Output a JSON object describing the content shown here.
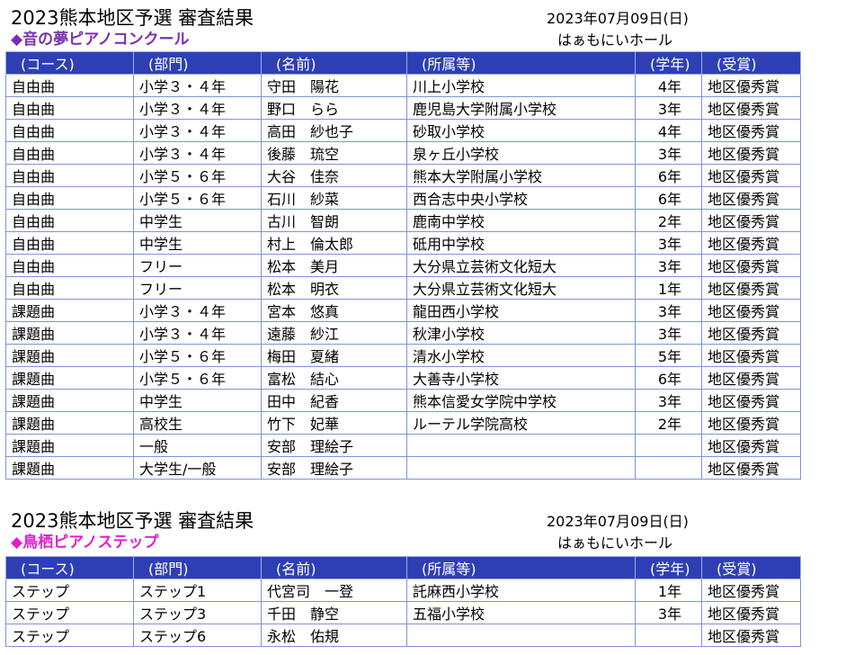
{
  "sections": [
    {
      "title": "2023熊本地区予選 審査結果",
      "date": "2023年07月09日(日)",
      "subtitle": "◆音の夢ピアノコンクール",
      "subtitle_color": "#7b2fb0",
      "venue": "はぁもにいホール",
      "columns": [
        "(コース)",
        "(部門)",
        "(名前)",
        "(所属等)",
        "(学年)",
        "(受賞)"
      ],
      "rows": [
        [
          "自由曲",
          "小学３・４年",
          "守田　陽花",
          "川上小学校",
          "4年",
          "地区優秀賞"
        ],
        [
          "自由曲",
          "小学３・４年",
          "野口　らら",
          "鹿児島大学附属小学校",
          "3年",
          "地区優秀賞"
        ],
        [
          "自由曲",
          "小学３・４年",
          "高田　紗也子",
          "砂取小学校",
          "4年",
          "地区優秀賞"
        ],
        [
          "自由曲",
          "小学３・４年",
          "後藤　琉空",
          "泉ヶ丘小学校",
          "3年",
          "地区優秀賞"
        ],
        [
          "自由曲",
          "小学５・６年",
          "大谷　佳奈",
          "熊本大学附属小学校",
          "6年",
          "地区優秀賞"
        ],
        [
          "自由曲",
          "小学５・６年",
          "石川　紗菜",
          "西合志中央小学校",
          "6年",
          "地区優秀賞"
        ],
        [
          "自由曲",
          "中学生",
          "古川　智朗",
          "鹿南中学校",
          "2年",
          "地区優秀賞"
        ],
        [
          "自由曲",
          "中学生",
          "村上　倫太郎",
          "砥用中学校",
          "3年",
          "地区優秀賞"
        ],
        [
          "自由曲",
          "フリー",
          "松本　美月",
          "大分県立芸術文化短大",
          "3年",
          "地区優秀賞"
        ],
        [
          "自由曲",
          "フリー",
          "松本　明衣",
          "大分県立芸術文化短大",
          "1年",
          "地区優秀賞"
        ],
        [
          "課題曲",
          "小学３・４年",
          "宮本　悠真",
          "龍田西小学校",
          "3年",
          "地区優秀賞"
        ],
        [
          "課題曲",
          "小学３・４年",
          "遠藤　紗江",
          "秋津小学校",
          "3年",
          "地区優秀賞"
        ],
        [
          "課題曲",
          "小学５・６年",
          "梅田　夏緒",
          "清水小学校",
          "5年",
          "地区優秀賞"
        ],
        [
          "課題曲",
          "小学５・６年",
          "富松　結心",
          "大善寺小学校",
          "6年",
          "地区優秀賞"
        ],
        [
          "課題曲",
          "中学生",
          "田中　紀香",
          "熊本信愛女学院中学校",
          "3年",
          "地区優秀賞"
        ],
        [
          "課題曲",
          "高校生",
          "竹下　妃華",
          "ルーテル学院高校",
          "2年",
          "地区優秀賞"
        ],
        [
          "課題曲",
          "一般",
          "安部　理絵子",
          "",
          "",
          "地区優秀賞"
        ],
        [
          "課題曲",
          "大学生/一般",
          "安部　理絵子",
          "",
          "",
          "地区優秀賞"
        ]
      ]
    },
    {
      "title": "2023熊本地区予選 審査結果",
      "date": "2023年07月09日(日)",
      "subtitle": "◆鳥栖ピアノステップ",
      "subtitle_color": "#e020d0",
      "venue": "はぁもにいホール",
      "columns": [
        "(コース)",
        "(部門)",
        "(名前)",
        "(所属等)",
        "(学年)",
        "(受賞)"
      ],
      "rows": [
        [
          "ステップ",
          "ステップ1",
          "代宮司　一登",
          "託麻西小学校",
          "1年",
          "地区優秀賞"
        ],
        [
          "ステップ",
          "ステップ3",
          "千田　静空",
          "五福小学校",
          "3年",
          "地区優秀賞"
        ],
        [
          "ステップ",
          "ステップ6",
          "永松　佑規",
          "",
          "",
          "地区優秀賞"
        ]
      ]
    }
  ]
}
